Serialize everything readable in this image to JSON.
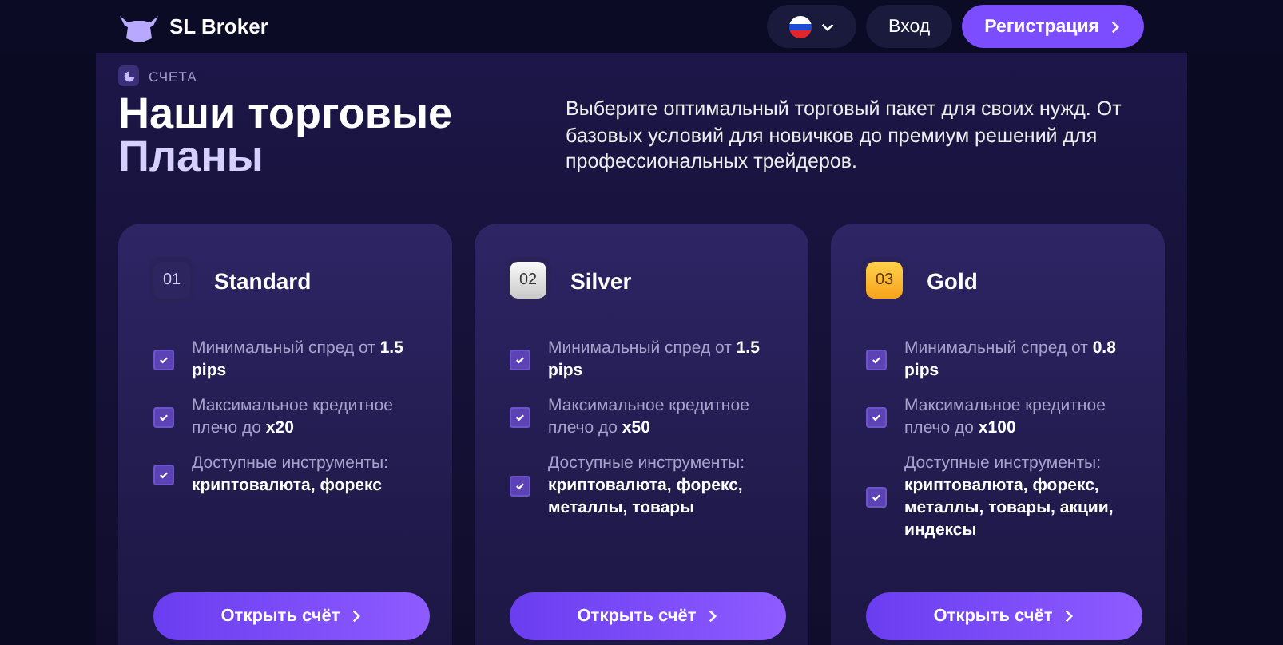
{
  "header": {
    "brand": "SL Broker",
    "login": "Вход",
    "register": "Регистрация"
  },
  "section": {
    "tag": "СЧЕТА",
    "title_line1": "Наши торговые",
    "title_line2": "Планы",
    "description": "Выберите оптимальный торговый пакет для своих нужд. От базовых условий для новичков до премиум решений для профессиональных трейдеров."
  },
  "plans": [
    {
      "number": "01",
      "kind": "standard",
      "name": "Standard",
      "features": [
        {
          "text": "Минимальный спред от **1.5 pips**",
          "checked": true
        },
        {
          "text": "Максимальное кредитное плечо до **x20**",
          "checked": true
        },
        {
          "text": "Доступные инструменты: **криптовалюта, форекс**",
          "checked": true
        }
      ],
      "button": "Открыть счёт"
    },
    {
      "number": "02",
      "kind": "silver",
      "name": "Silver",
      "features": [
        {
          "text": "Минимальный спред от **1.5 pips**",
          "checked": true
        },
        {
          "text": "Максимальное кредитное плечо до **x50**",
          "checked": true
        },
        {
          "text": "Доступные инструменты: **криптовалюта, форекс, металлы, товары**",
          "checked": true
        }
      ],
      "button": "Открыть счёт"
    },
    {
      "number": "03",
      "kind": "gold",
      "name": "Gold",
      "features": [
        {
          "text": "Минимальный спред от **0.8 pips**",
          "checked": true
        },
        {
          "text": "Максимальное кредитное плечо до **x100**",
          "checked": true
        },
        {
          "text": "Доступные инструменты: **криптовалюта, форекс, металлы, товары, акции, индексы**",
          "checked": true
        }
      ],
      "button": "Открыть счёт"
    }
  ]
}
